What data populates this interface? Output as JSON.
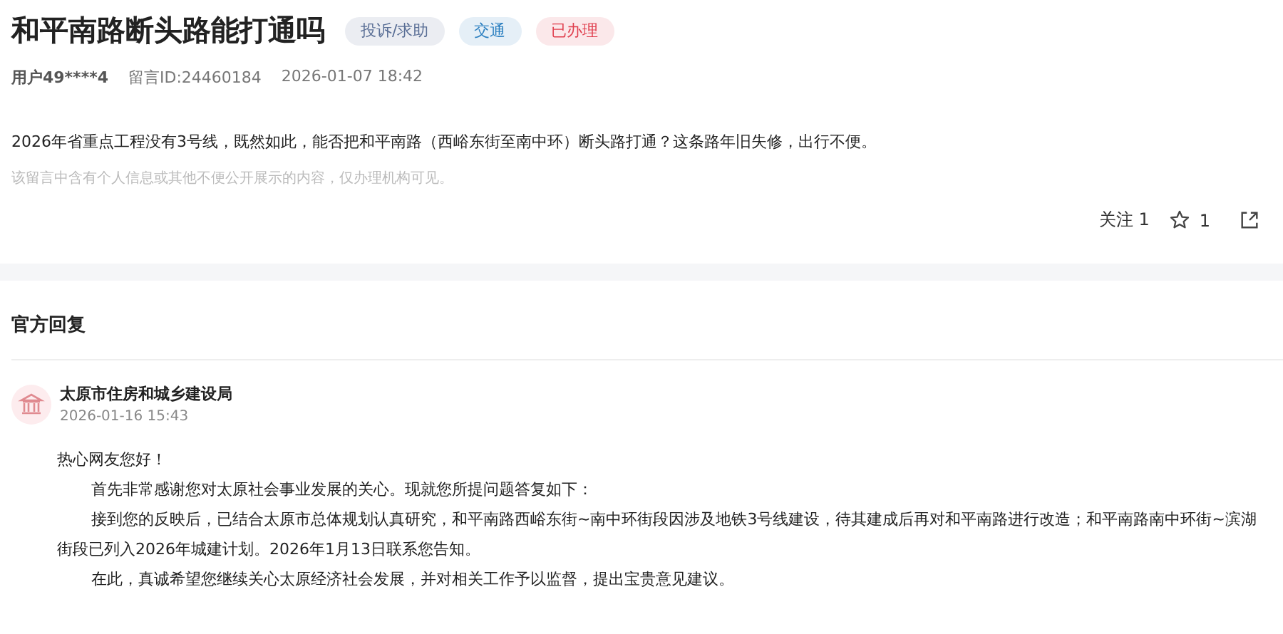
{
  "title": "和平南路断头路能打通吗",
  "tags": [
    {
      "label": "投诉/求助",
      "color": "#5a6f96"
    },
    {
      "label": "交通",
      "color": "#2b7fc0"
    },
    {
      "label": "已办理",
      "color": "#e0404f"
    }
  ],
  "meta": {
    "user": "用户49****4",
    "message_id": "留言ID:24460184",
    "time": "2026-01-07 18:42"
  },
  "content": "2026年省重点工程没有3号线，既然如此，能否把和平南路（西峪东街至南中环）断头路打通？这条路年旧失修，出行不便。",
  "privacy_note": "该留言中含有个人信息或其他不便公开展示的内容，仅办理机构可见。",
  "actions": {
    "follow_label": "关注 1",
    "stars": "1"
  },
  "reply": {
    "heading": "官方回复",
    "agency": "太原市住房和城乡建设局",
    "time": "2026-01-16 15:43",
    "paragraphs": [
      {
        "text": "热心网友您好！",
        "indent": false
      },
      {
        "text": "首先非常感谢您对太原社会事业发展的关心。现就您所提问题答复如下：",
        "indent": true
      },
      {
        "text": "接到您的反映后，已结合太原市总体规划认真研究，和平南路西峪东街~南中环街段因涉及地铁3号线建设，待其建成后再对和平南路进行改造；和平南路南中环街~滨湖街段已列入2026年城建计划。2026年1月13日联系您告知。",
        "indent": true
      },
      {
        "text": "在此，真诚希望您继续关心太原经济社会发展，并对相关工作予以监督，提出宝贵意见建议。",
        "indent": true
      }
    ]
  }
}
